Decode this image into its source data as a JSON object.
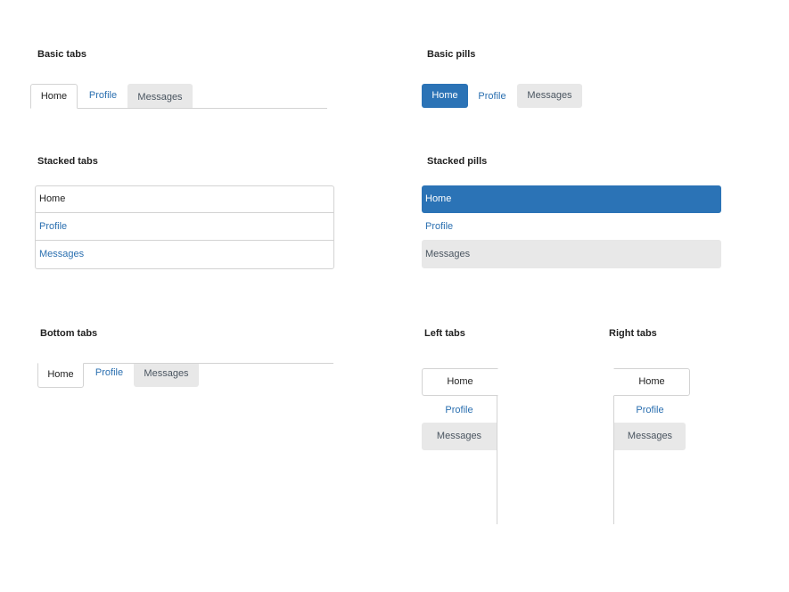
{
  "sections": {
    "basic_tabs": "Basic tabs",
    "basic_pills": "Basic pills",
    "stacked_tabs": "Stacked tabs",
    "stacked_pills": "Stacked pills",
    "bottom_tabs": "Bottom tabs",
    "left_tabs": "Left tabs",
    "right_tabs": "Right tabs"
  },
  "nav": {
    "home": "Home",
    "profile": "Profile",
    "messages": "Messages"
  },
  "colors": {
    "link": "#2a6fb0",
    "active_pill": "#2b73b6",
    "hover_bg": "#e8e8e8",
    "border": "#d3d3d3"
  }
}
